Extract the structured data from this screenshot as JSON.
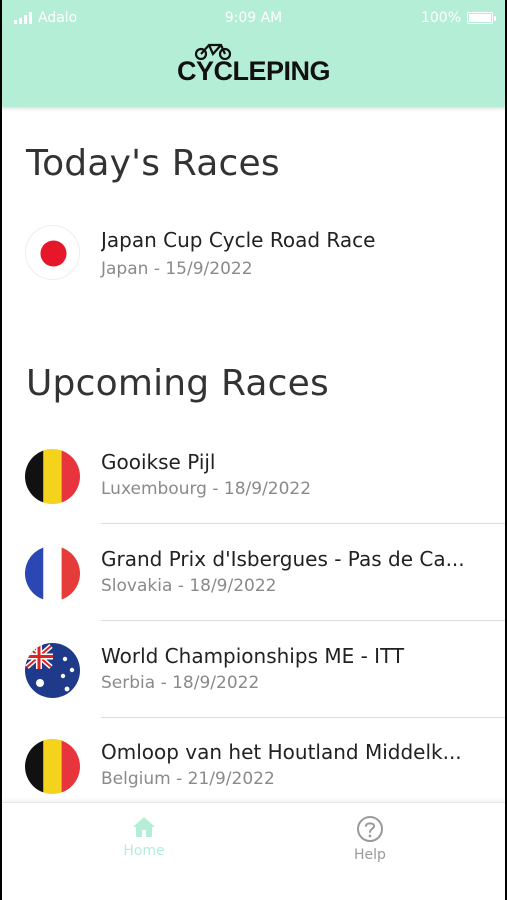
{
  "status_bar": {
    "carrier": "Adalo",
    "time": "9:09 AM",
    "battery": "100%"
  },
  "header": {
    "logo_text": "CYCLEPING"
  },
  "today": {
    "title": "Today's Races",
    "races": [
      {
        "name": "Japan Cup Cycle Road Race",
        "subtitle": "Japan - 15/9/2022",
        "flag": "japan-flag-icon"
      }
    ]
  },
  "upcoming": {
    "title": "Upcoming Races",
    "races": [
      {
        "name": "Gooikse Pijl",
        "subtitle": "Luxembourg - 18/9/2022",
        "flag": "belgium-flag-icon"
      },
      {
        "name": "Grand Prix d'Isbergues - Pas de Ca...",
        "subtitle": "Slovakia - 18/9/2022",
        "flag": "france-flag-icon"
      },
      {
        "name": "World Championships ME - ITT",
        "subtitle": "Serbia - 18/9/2022",
        "flag": "australia-flag-icon"
      },
      {
        "name": "Omloop van het Houtland Middelk...",
        "subtitle": "Belgium - 21/9/2022",
        "flag": "belgium-flag-icon"
      }
    ]
  },
  "tabbar": {
    "home_label": "Home",
    "help_label": "Help",
    "active_color": "#b5eed6",
    "inactive_color": "#9a9a9a"
  },
  "colors": {
    "accent": "#b5eed6",
    "japan_red": "#e6172b",
    "belgium_black": "#111111",
    "belgium_yellow": "#f5d31c",
    "belgium_red": "#e8343c",
    "france_blue": "#2b47b4",
    "france_red": "#e63b3b"
  }
}
